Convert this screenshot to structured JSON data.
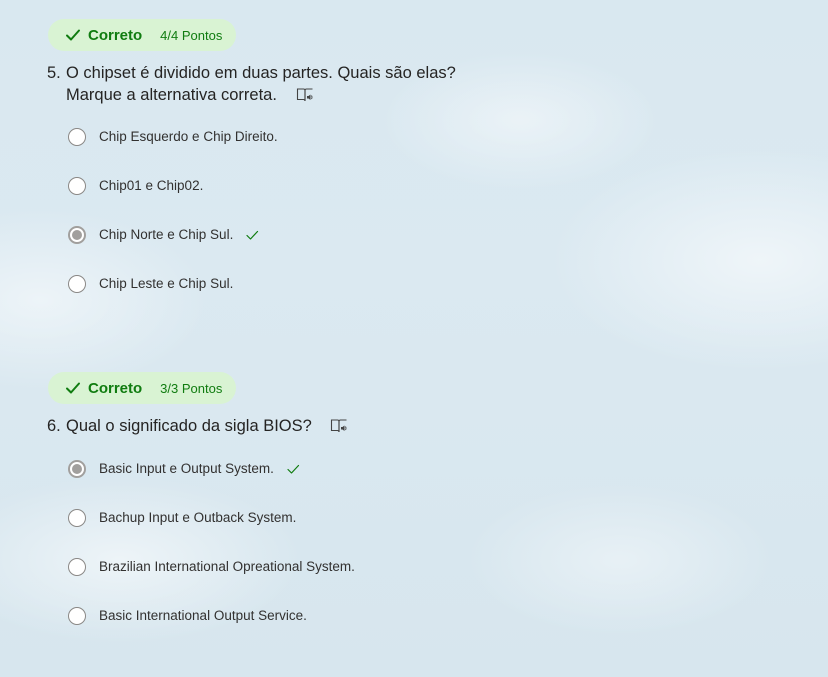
{
  "questions": [
    {
      "status": "Correto",
      "points": "4/4 Pontos",
      "number": "5.",
      "title_line1": "O chipset é dividido em duas partes. Quais são elas?",
      "title_line2": "Marque a alternativa correta.",
      "options": [
        {
          "label": "Chip Esquerdo e Chip Direito.",
          "selected": false,
          "correct": false
        },
        {
          "label": "Chip01 e Chip02.",
          "selected": false,
          "correct": false
        },
        {
          "label": "Chip Norte e Chip Sul.",
          "selected": true,
          "correct": true
        },
        {
          "label": "Chip Leste e Chip Sul.",
          "selected": false,
          "correct": false
        }
      ]
    },
    {
      "status": "Correto",
      "points": "3/3 Pontos",
      "number": "6.",
      "title_line1": "Qual o significado da sigla BIOS?",
      "options": [
        {
          "label": "Basic Input e Output System.",
          "selected": true,
          "correct": true
        },
        {
          "label": "Bachup Input e Outback System.",
          "selected": false,
          "correct": false
        },
        {
          "label": "Brazilian International Opreational System.",
          "selected": false,
          "correct": false
        },
        {
          "label": "Basic International Output Service.",
          "selected": false,
          "correct": false
        }
      ]
    }
  ],
  "colors": {
    "correct_green": "#107c10",
    "badge_bg": "#d9f3d3",
    "selected_radio": "#a19f9d"
  },
  "icons": {
    "badge": "check-icon",
    "reader": "immersive-reader-icon",
    "correct": "checkmark-icon"
  }
}
